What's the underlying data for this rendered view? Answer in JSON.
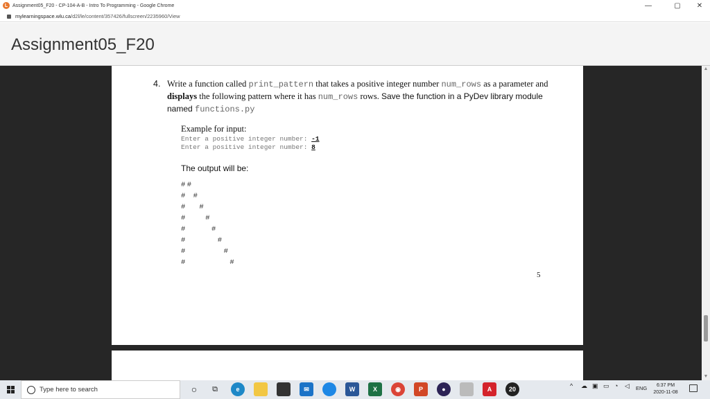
{
  "browser": {
    "tab_title": "Assignment05_F20 - CP-104-A-B - Intro To Programming - Google Chrome",
    "url_domain": "mylearningspace.wlu.ca",
    "url_path": "/d2l/le/content/357426/fullscreen/2235960/View",
    "favicon_text": "L",
    "minimize": "—",
    "restore": "▢",
    "close": "✕"
  },
  "header": {
    "title": "Assignment05_F20"
  },
  "question": {
    "number": "4.",
    "part1": "Write a function called ",
    "code1": "print_pattern",
    "part2": " that takes a positive integer number ",
    "code2": "num_rows",
    "part3": " as a parameter and ",
    "bold1": "displays",
    "part4": " the following pattern where it has ",
    "code3": "num_rows",
    "part5": " rows. ",
    "sans1": "Save the function in a PyDev library module named ",
    "code4": "functions.py"
  },
  "example": {
    "label": "Example for input:",
    "line1_prompt": "Enter a positive integer number: ",
    "line1_value": "-1",
    "line2_prompt": "Enter a positive integer number: ",
    "line2_value": "8"
  },
  "output": {
    "label": "The output will be:",
    "rows": [
      "##",
      "# #",
      "#  #",
      "#   #",
      "#    #",
      "#     #",
      "#      #",
      "#       #"
    ]
  },
  "page_number": "5",
  "taskbar": {
    "search_placeholder": "Type here to search",
    "badge_count": "20",
    "tray_lang": "ENG",
    "time": "6:37 PM",
    "date": "2020-11-08"
  },
  "colors": {
    "viewer_bg": "#262626",
    "taskbar_bg": "#e5e9ee",
    "header_bg": "#f4f4f4"
  }
}
